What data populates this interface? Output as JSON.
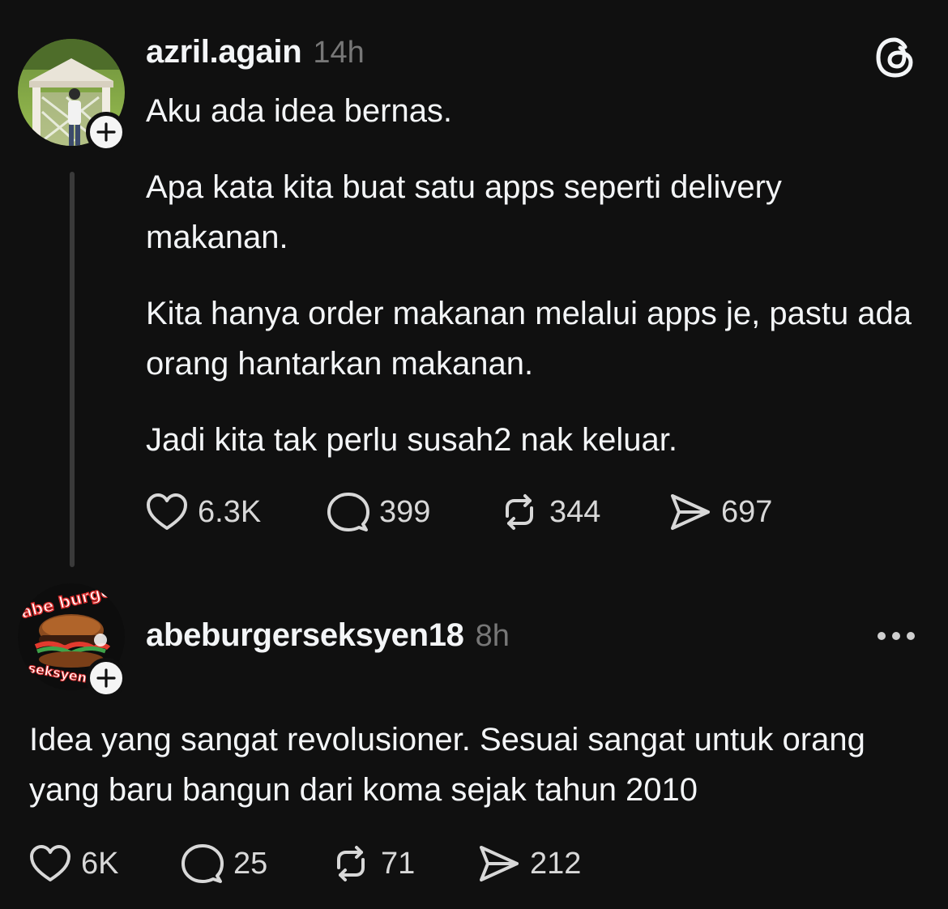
{
  "posts": [
    {
      "username": "azril.again",
      "time": "14h",
      "paragraphs": [
        "Aku ada idea bernas.",
        "Apa kata kita buat satu apps seperti delivery makanan.",
        "Kita hanya order makanan melalui apps je, pastu ada orang hantarkan makanan.",
        "Jadi kita tak perlu susah2 nak keluar."
      ],
      "likes": "6.3K",
      "replies": "399",
      "reposts": "344",
      "shares": "697"
    },
    {
      "username": "abeburgerseksyen18",
      "time": "8h",
      "avatar_text": [
        "abe burger",
        "seksyen"
      ],
      "paragraphs": [
        "Idea yang sangat revolusioner. Sesuai sangat untuk orang yang baru bangun dari koma sejak tahun 2010"
      ],
      "likes": "6K",
      "replies": "25",
      "reposts": "71",
      "shares": "212"
    }
  ],
  "icons": {
    "app_logo": "threads-logo-icon",
    "more": "more-options-icon",
    "follow": "plus-icon",
    "like": "heart-icon",
    "reply": "comment-icon",
    "repost": "repost-icon",
    "share": "send-icon"
  },
  "colors": {
    "background": "#101010",
    "text_primary": "#f3f5f7",
    "text_secondary": "#777777",
    "thread_line": "#3a3a3a",
    "badge_bg": "#f5f5f5"
  }
}
